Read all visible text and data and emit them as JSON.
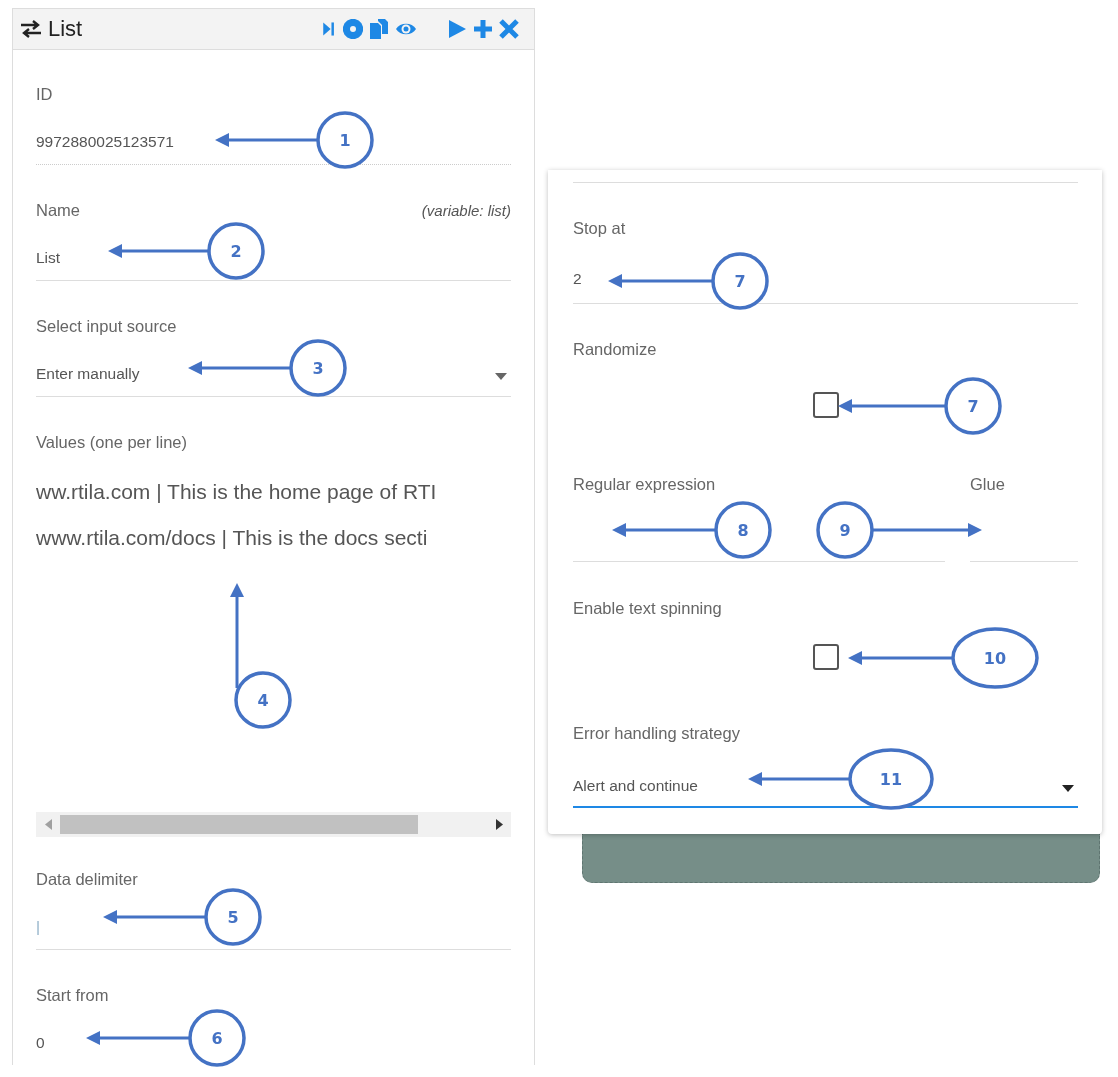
{
  "panel": {
    "title": "List"
  },
  "left_fields": [
    {
      "kind": "text",
      "label": "ID",
      "value": "9972880025123571",
      "dotted": true
    },
    {
      "kind": "text",
      "label": "Name",
      "hint": "(variable:  list)",
      "value": "List"
    },
    {
      "kind": "select",
      "label": "Select input source",
      "value": "Enter manually",
      "focused": false
    },
    {
      "kind": "textarea",
      "label": "Values (one per line)",
      "lines": [
        "ww.rtila.com | This is the home page of RTI",
        "www.rtila.com/docs | This is the docs secti"
      ]
    },
    {
      "kind": "text",
      "label": "Data delimiter",
      "value": "|",
      "faint": true
    },
    {
      "kind": "text",
      "label": "Start from",
      "value": "0"
    }
  ],
  "right_fields": [
    {
      "kind": "text",
      "label": "Stop at",
      "value": "2"
    },
    {
      "kind": "checkbox",
      "label": "Randomize",
      "checked": false
    },
    {
      "kind": "pair",
      "fields": [
        {
          "label": "Regular expression"
        },
        {
          "label": "Glue"
        }
      ]
    },
    {
      "kind": "checkbox",
      "label": "Enable text spinning",
      "checked": false
    },
    {
      "kind": "select",
      "label": "Error handling strategy",
      "value": "Alert and continue",
      "focused": true
    }
  ],
  "callouts": [
    {
      "label": "1"
    },
    {
      "label": "2"
    },
    {
      "label": "3"
    },
    {
      "label": "4"
    },
    {
      "label": "5"
    },
    {
      "label": "6"
    },
    {
      "label": "7"
    },
    {
      "label": "7"
    },
    {
      "label": "8"
    },
    {
      "label": "9"
    },
    {
      "label": "10"
    },
    {
      "label": "11"
    }
  ]
}
